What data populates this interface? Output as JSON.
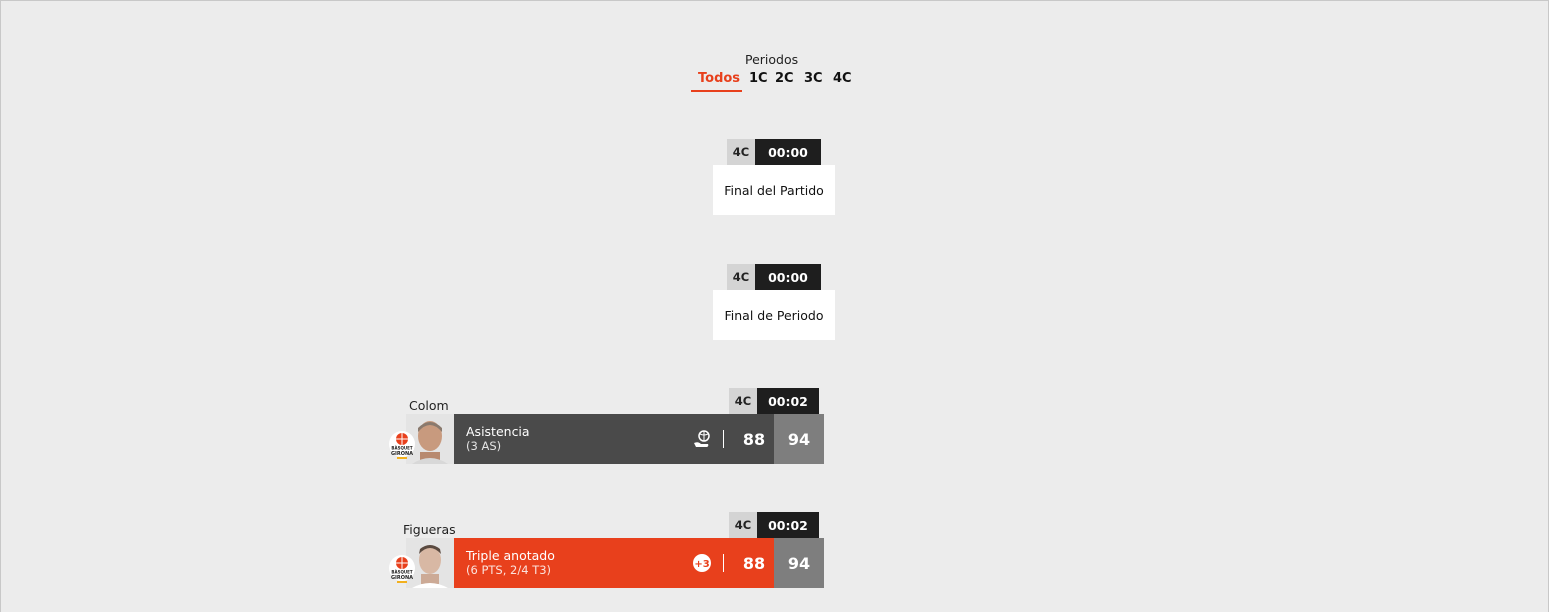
{
  "periods": {
    "label": "Periodos",
    "tabs": [
      "Todos",
      "1C",
      "2C",
      "3C",
      "4C"
    ],
    "active": "Todos"
  },
  "events": [
    {
      "quarter": "4C",
      "clock": "00:00",
      "text": "Final del Partido"
    },
    {
      "quarter": "4C",
      "clock": "00:00",
      "text": "Final de Periodo"
    }
  ],
  "plays": [
    {
      "quarter": "4C",
      "clock": "00:02",
      "player": "Colom",
      "action": "Asistencia",
      "detail": "(3 AS)",
      "icon": "assist-icon",
      "home_score": "88",
      "away_score": "94",
      "team_logo_text": [
        "BÀSQUET",
        "GIRONA"
      ],
      "color": "#4a4a4a"
    },
    {
      "quarter": "4C",
      "clock": "00:02",
      "player": "Figueras",
      "action": "Triple anotado",
      "detail": "(6 PTS, 2/4 T3)",
      "icon": "plus-three-icon",
      "icon_text": "+3",
      "home_score": "88",
      "away_score": "94",
      "team_logo_text": [
        "BÀSQUET",
        "GIRONA"
      ],
      "color": "#e8401c"
    }
  ],
  "colors": {
    "accent": "#e8401c",
    "dark_bar": "#4a4a4a",
    "away_score_bg": "#7e7e7e"
  }
}
